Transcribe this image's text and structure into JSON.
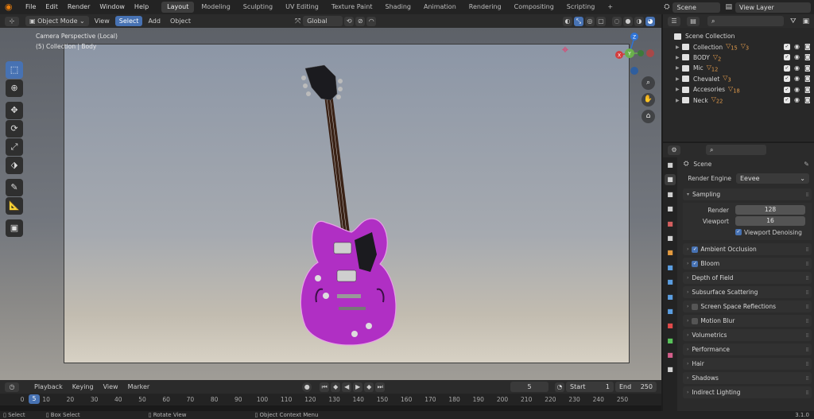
{
  "top_menu": {
    "items": [
      "File",
      "Edit",
      "Render",
      "Window",
      "Help"
    ]
  },
  "workspaces": {
    "tabs": [
      "Layout",
      "Modeling",
      "Sculpting",
      "UV Editing",
      "Texture Paint",
      "Shading",
      "Animation",
      "Rendering",
      "Compositing",
      "Scripting"
    ],
    "active": "Layout",
    "add": "+"
  },
  "scene_selector": {
    "value": "Scene"
  },
  "view_layer": {
    "value": "View Layer"
  },
  "viewport_header": {
    "mode": "Object Mode",
    "menus": [
      "View",
      "Select",
      "Add",
      "Object"
    ],
    "selected_menu": "Select",
    "transform_orientation": "Global"
  },
  "viewport": {
    "overlay_line1": "Camera Perspective (Local)",
    "overlay_line2": "(5) Collection | Body",
    "gizmo": {
      "z": "Z",
      "y": "Y",
      "x": "X"
    }
  },
  "icons": {
    "blender": "blender-logo-icon",
    "tools": [
      "select-box-icon",
      "cursor-icon",
      "move-icon",
      "rotate-icon",
      "scale-icon",
      "transform-icon",
      "annotate-icon",
      "measure-icon",
      "add-cube-icon"
    ],
    "nav": [
      "zoom-icon",
      "hand-pan-icon",
      "camera-icon",
      "perspective-icon"
    ]
  },
  "outliner": {
    "root": "Scene Collection",
    "items": [
      {
        "name": "Collection",
        "badge": "15",
        "badge2": "3"
      },
      {
        "name": "BODY",
        "badge": "2"
      },
      {
        "name": "Mic",
        "badge": "12"
      },
      {
        "name": "Chevalet",
        "badge": "3"
      },
      {
        "name": "Accesories",
        "badge": "18"
      },
      {
        "name": "Neck",
        "badge": "22"
      }
    ]
  },
  "properties": {
    "context": "Scene",
    "render_engine_label": "Render Engine",
    "render_engine_value": "Eevee",
    "sampling": {
      "title": "Sampling",
      "render_label": "Render",
      "render_value": "128",
      "viewport_label": "Viewport",
      "viewport_value": "16",
      "denoise_label": "Viewport Denoising"
    },
    "panels": [
      {
        "label": "Ambient Occlusion",
        "checkbox": "on"
      },
      {
        "label": "Bloom",
        "checkbox": "on"
      },
      {
        "label": "Depth of Field",
        "checkbox": "none"
      },
      {
        "label": "Subsurface Scattering",
        "checkbox": "none"
      },
      {
        "label": "Screen Space Reflections",
        "checkbox": "off"
      },
      {
        "label": "Motion Blur",
        "checkbox": "off"
      },
      {
        "label": "Volumetrics",
        "checkbox": "none"
      },
      {
        "label": "Performance",
        "checkbox": "none"
      },
      {
        "label": "Hair",
        "checkbox": "none"
      },
      {
        "label": "Shadows",
        "checkbox": "none"
      },
      {
        "label": "Indirect Lighting",
        "checkbox": "none"
      }
    ],
    "tab_colors": [
      "#d0d0d0",
      "#d0d0d0",
      "#d0d0d0",
      "#d0d0d0",
      "#d35e5e",
      "#d0d0d0",
      "#e39a3f",
      "#5a9de0",
      "#5a9de0",
      "#5a9de0",
      "#5a9de0",
      "#e14a4a",
      "#58c35a",
      "#d35e8a",
      "#d0d0d0"
    ]
  },
  "timeline": {
    "menus": [
      "Playback",
      "Keying",
      "View",
      "Marker"
    ],
    "current_frame": "5",
    "start_label": "Start",
    "start_value": "1",
    "end_label": "End",
    "end_value": "250",
    "ticks": [
      "0",
      "10",
      "20",
      "30",
      "40",
      "50",
      "60",
      "70",
      "80",
      "90",
      "100",
      "110",
      "120",
      "130",
      "140",
      "150",
      "160",
      "170",
      "180",
      "190",
      "200",
      "210",
      "220",
      "230",
      "240",
      "250"
    ],
    "playhead": "5"
  },
  "statusbar": {
    "items": [
      "Select",
      "Box Select",
      "Rotate View",
      "Object Context Menu"
    ],
    "version": "3.1.0"
  },
  "colors": {
    "accent": "#4772b3",
    "guitar_body": "#b02fc4",
    "guitar_head": "#1b1b1f"
  }
}
